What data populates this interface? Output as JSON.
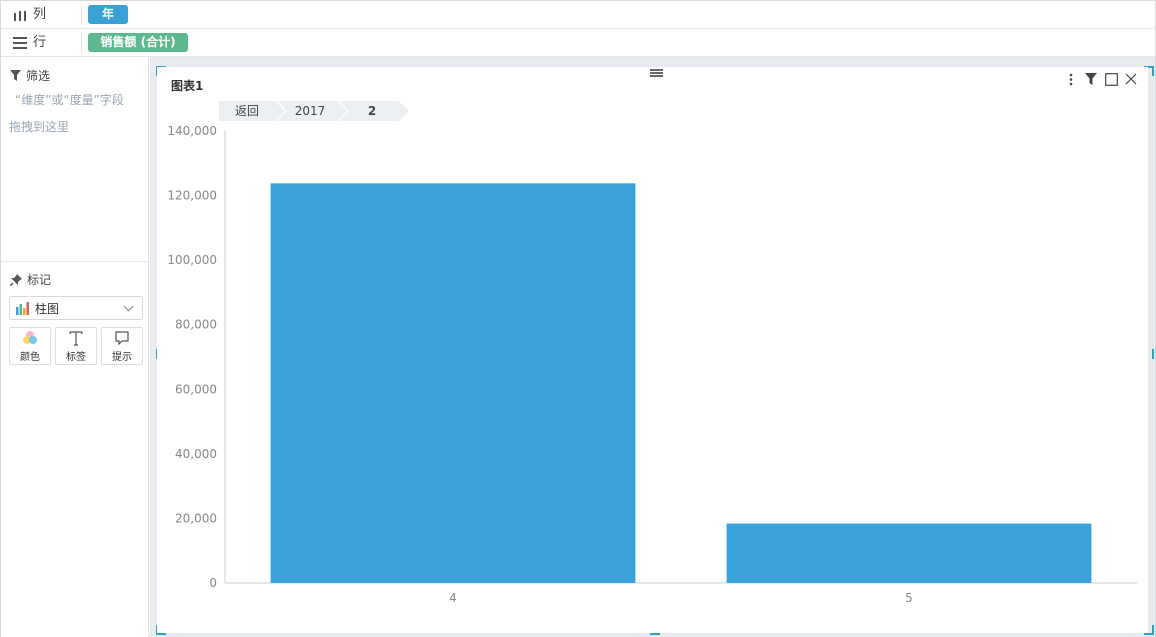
{
  "shelves": {
    "columns": {
      "label": "列",
      "pill": "年"
    },
    "rows": {
      "label": "行",
      "pill": "销售额 (合计)"
    }
  },
  "filter": {
    "title": "筛选",
    "hint_line1": "“维度”或“度量”字段",
    "hint_line2": "拖拽到这里"
  },
  "marks": {
    "title": "标记",
    "chart_type": "柱图",
    "buttons": [
      {
        "label": "颜色",
        "icon": "color-palette-icon"
      },
      {
        "label": "标签",
        "icon": "text-label-icon"
      },
      {
        "label": "提示",
        "icon": "tooltip-icon"
      }
    ]
  },
  "card": {
    "title": "图表1",
    "breadcrumbs": [
      "返回",
      "2017",
      "2"
    ]
  },
  "colors": {
    "bar": "#3aa1d9",
    "accent": "#2ea0c9",
    "pill_year": "#3aa1d6",
    "pill_sales": "#5cb88e"
  },
  "chart_data": {
    "type": "bar",
    "categories": [
      "4",
      "5"
    ],
    "values": [
      123800,
      18400
    ],
    "ylim": [
      0,
      140000
    ],
    "yticks": [
      0,
      20000,
      40000,
      60000,
      80000,
      100000,
      120000,
      140000
    ],
    "ytick_labels": [
      "0",
      "20,000",
      "40,000",
      "60,000",
      "80,000",
      "100,000",
      "120,000",
      "140,000"
    ],
    "grid": false,
    "title": "",
    "xlabel": "",
    "ylabel": ""
  }
}
